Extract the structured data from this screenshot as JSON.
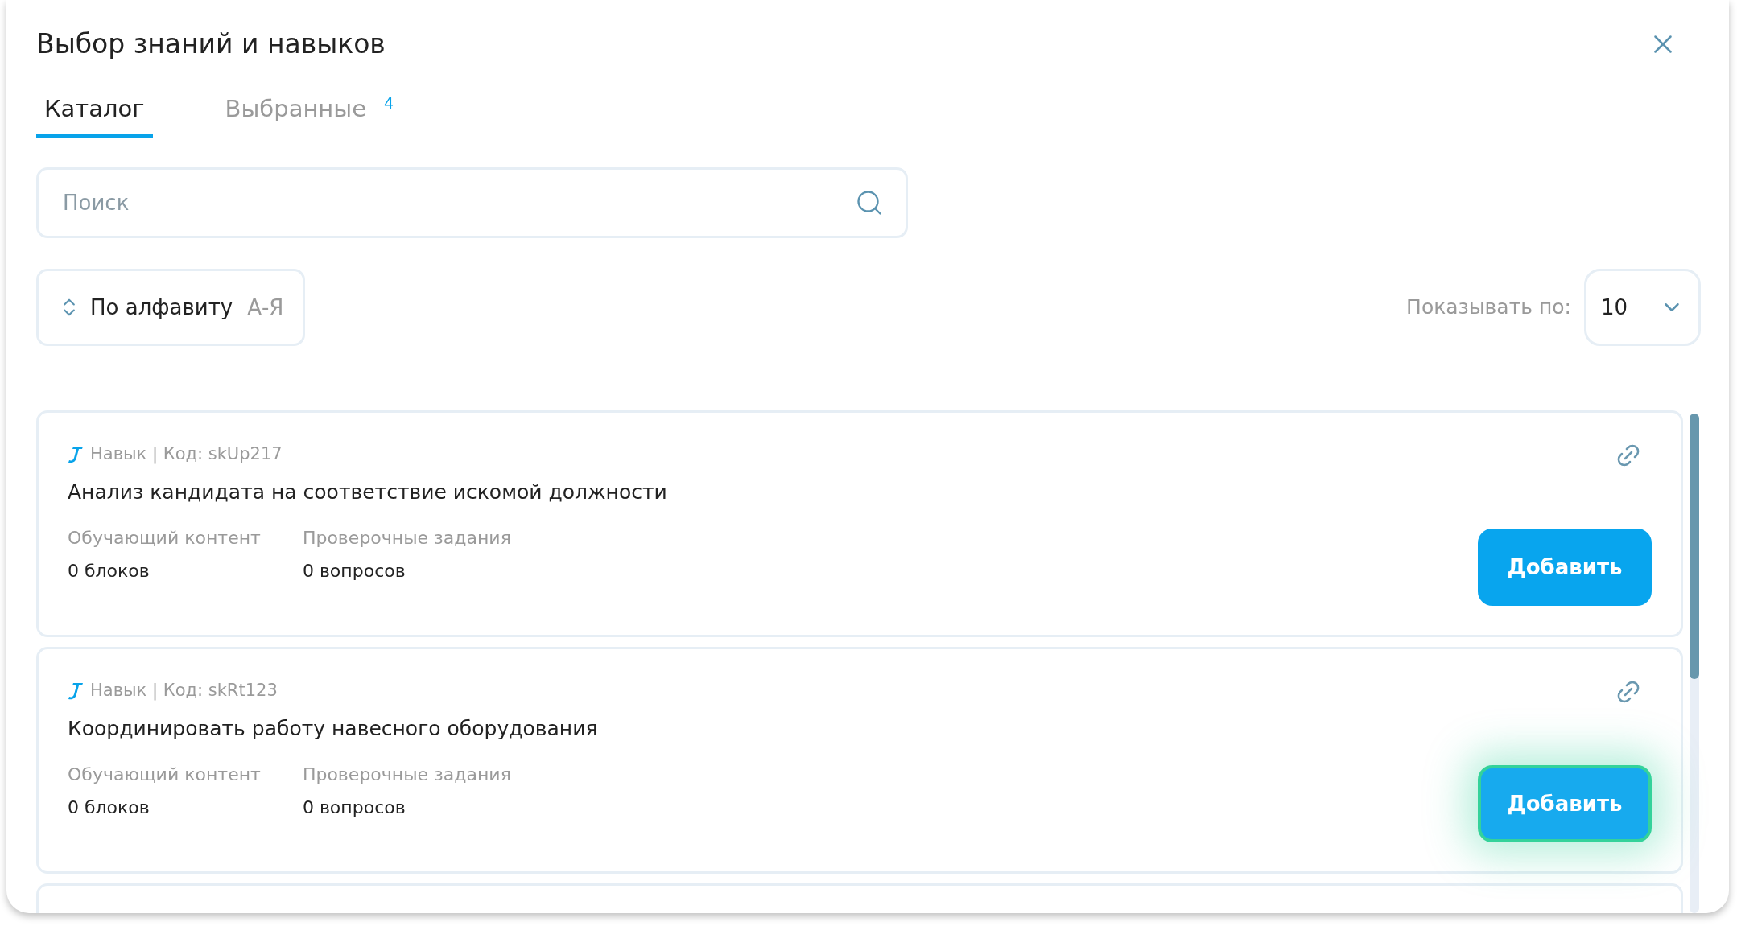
{
  "dialog": {
    "title": "Выбор знаний и навыков"
  },
  "tabs": [
    {
      "label": "Каталог",
      "selected": true
    },
    {
      "label": "Выбранные",
      "selected": false,
      "count": "4"
    }
  ],
  "search": {
    "placeholder": "Поиск"
  },
  "sort": {
    "label": "По алфавиту",
    "order": "А-Я"
  },
  "page_size": {
    "label": "Показывать по:",
    "value": "10"
  },
  "items": [
    {
      "type": "Навык | Код: skUp217",
      "name": "Анализ кандидата на соответствие искомой должности",
      "content_label": "Обучающий контент",
      "content_value": "0 блоков",
      "tasks_label": "Проверочные задания",
      "tasks_value": "0 вопросов",
      "button": "Добавить",
      "focused": false
    },
    {
      "type": "Навык | Код: skRt123",
      "name": "Координировать работу навесного оборудования",
      "content_label": "Обучающий контент",
      "content_value": "0 блоков",
      "tasks_label": "Проверочные задания",
      "tasks_value": "0 вопросов",
      "button": "Добавить",
      "focused": true
    }
  ]
}
